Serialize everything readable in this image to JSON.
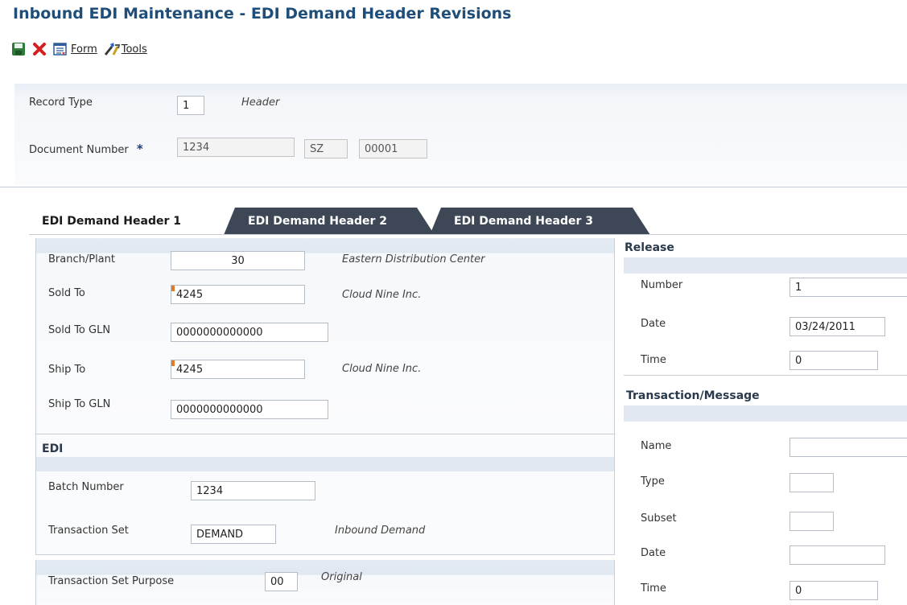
{
  "window": {
    "title": "Inbound EDI Maintenance - EDI Demand Header Revisions"
  },
  "toolbar": {
    "save_icon": "save-disk-icon",
    "cancel_icon": "red-x-icon",
    "form_icon": "form-icon",
    "form_label": "Form",
    "tools_icon": "tools-icon",
    "tools_label": "Tools"
  },
  "header": {
    "record_type_label": "Record Type",
    "record_type_value": "1",
    "record_type_desc": "Header",
    "doc_number_label": "Document Number",
    "doc_required_marker": "*",
    "doc_number_value": "1234",
    "doc_type_value": "SZ",
    "doc_company_value": "00001"
  },
  "tabs": [
    {
      "label": "EDI Demand Header 1",
      "active": true
    },
    {
      "label": "EDI Demand Header 2",
      "active": false
    },
    {
      "label": "EDI Demand Header 3",
      "active": false
    }
  ],
  "address": {
    "branch_plant_label": "Branch/Plant",
    "branch_plant_value": "30",
    "branch_plant_desc": "Eastern Distribution Center",
    "sold_to_label": "Sold To",
    "sold_to_value": "4245",
    "sold_to_desc": "Cloud Nine Inc.",
    "sold_to_gln_label": "Sold To GLN",
    "sold_to_gln_value": "0000000000000",
    "ship_to_label": "Ship To",
    "ship_to_value": "4245",
    "ship_to_desc": "Cloud Nine Inc.",
    "ship_to_gln_label": "Ship To GLN",
    "ship_to_gln_value": "0000000000000"
  },
  "edi": {
    "section_title": "EDI",
    "batch_number_label": "Batch Number",
    "batch_number_value": "1234",
    "transaction_set_label": "Transaction Set",
    "transaction_set_value": "DEMAND",
    "transaction_set_desc": "Inbound Demand",
    "purpose_label": "Transaction Set Purpose",
    "purpose_value": "00",
    "purpose_desc": "Original"
  },
  "release": {
    "section_title": "Release",
    "number_label": "Number",
    "number_value": "1",
    "date_label": "Date",
    "date_value": "03/24/2011",
    "time_label": "Time",
    "time_value": "0"
  },
  "transaction": {
    "section_title": "Transaction/Message",
    "name_label": "Name",
    "name_value": "",
    "type_label": "Type",
    "type_value": "",
    "subset_label": "Subset",
    "subset_value": "",
    "date_label": "Date",
    "date_value": "",
    "time_label": "Time",
    "time_value": "0"
  },
  "colors": {
    "title": "#1f4e7a",
    "tab_inactive": "#3d4755",
    "required_flag": "#e07b28",
    "section_bar": "#e1e8f1"
  }
}
